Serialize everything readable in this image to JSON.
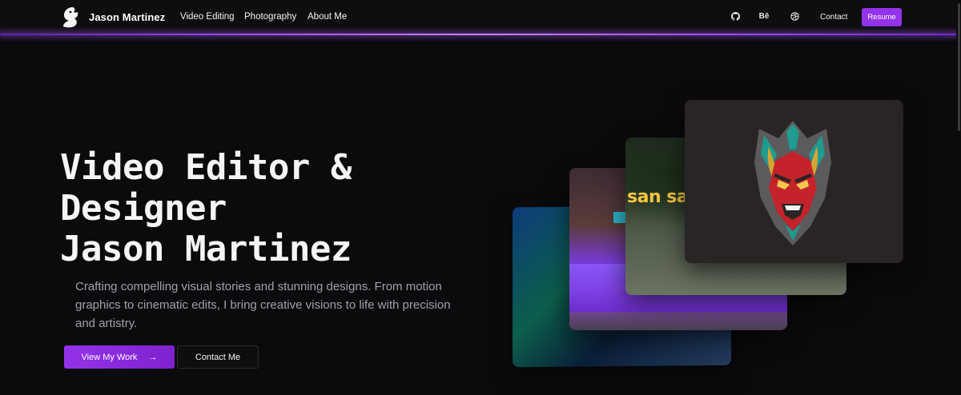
{
  "nav": {
    "brand": "Jason Martinez",
    "links": [
      "Video Editing",
      "Photography",
      "About Me"
    ],
    "icons": [
      "github-icon",
      "behance-icon",
      "dribbble-icon"
    ],
    "behance_glyph": "Bē",
    "contact": "Contact",
    "resume": "Resume"
  },
  "hero": {
    "title_lines": [
      "Video Editor &",
      "Designer",
      "Jason Martinez"
    ],
    "subtitle": "Crafting compelling visual stories and stunning designs. From motion graphics to cinematic edits, I bring creative visions to life with precision and artistry.",
    "primary_cta": "View My Work",
    "primary_cta_icon": "→",
    "secondary_cta": "Contact Me"
  },
  "cards": {
    "card3_text": "san sa"
  },
  "colors": {
    "accent": "#9333ea",
    "background": "#0b0a0d",
    "glow": "#a855f7"
  }
}
